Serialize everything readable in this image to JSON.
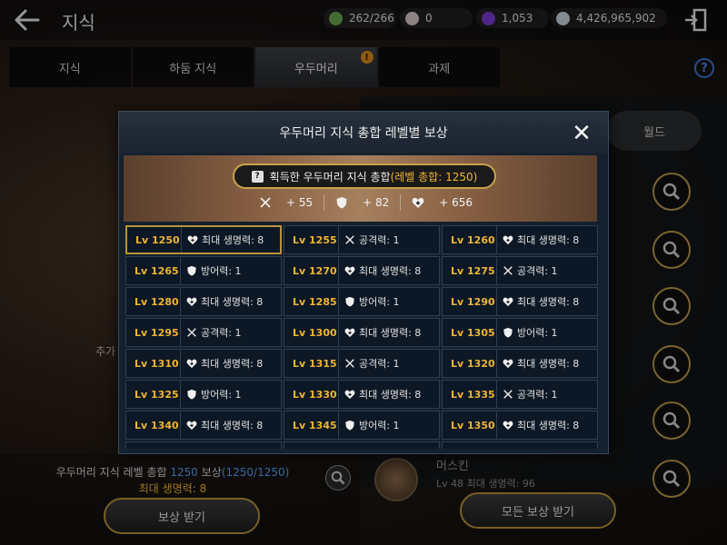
{
  "header": {
    "title": "지식",
    "resources": [
      {
        "name": "energy",
        "icon": "green-leaf-icon",
        "color": "#6aa84f",
        "value": "262/266"
      },
      {
        "name": "pearl",
        "icon": "pearl-icon",
        "color": "#d8c8c8",
        "value": "0"
      },
      {
        "name": "crystal",
        "icon": "purple-crystal-icon",
        "color": "#7a3ad0",
        "value": "1,053"
      },
      {
        "name": "silver",
        "icon": "silver-coin-icon",
        "color": "#c9d4e0",
        "value": "4,426,965,902"
      }
    ]
  },
  "tabs": [
    {
      "label": "지식",
      "active": false
    },
    {
      "label": "하둠 지식",
      "active": false
    },
    {
      "label": "우두머리",
      "active": true,
      "badge": "!"
    },
    {
      "label": "과제",
      "active": false
    }
  ],
  "background": {
    "world_tab": "월드",
    "left_label": "추가",
    "summary_line1_a": "우두머리 지식 레벨 총합 ",
    "summary_level": "1250",
    "summary_line1_b": " 보상",
    "summary_progress": "(1250/1250)",
    "summary_line2": "최대 생명력: 8",
    "reward_button": "보상 받기",
    "all_reward_button": "모든 보상 받기",
    "char_name": "머스킨",
    "char_sub": "Lv 48 최대 생명력: 96"
  },
  "modal": {
    "title": "우두머리 지식 총합 레벨별 보상",
    "banner": {
      "label": "획득한 우두머리 지식 총합",
      "total": "(레벨 총합: 1250)",
      "stats": [
        {
          "icon": "sword-icon",
          "value": "+ 55"
        },
        {
          "icon": "shield-icon",
          "value": "+ 82"
        },
        {
          "icon": "heart-icon",
          "value": "+ 656"
        }
      ]
    },
    "rewards": [
      {
        "lv": "Lv 1250",
        "icon": "heart-icon",
        "text": "최대 생명력: 8",
        "selected": true
      },
      {
        "lv": "Lv 1255",
        "icon": "sword-icon",
        "text": "공격력: 1"
      },
      {
        "lv": "Lv 1260",
        "icon": "heart-icon",
        "text": "최대 생명력: 8"
      },
      {
        "lv": "Lv 1265",
        "icon": "shield-icon",
        "text": "방어력: 1"
      },
      {
        "lv": "Lv 1270",
        "icon": "heart-icon",
        "text": "최대 생명력: 8"
      },
      {
        "lv": "Lv 1275",
        "icon": "sword-icon",
        "text": "공격력: 1"
      },
      {
        "lv": "Lv 1280",
        "icon": "heart-icon",
        "text": "최대 생명력: 8"
      },
      {
        "lv": "Lv 1285",
        "icon": "shield-icon",
        "text": "방어력: 1"
      },
      {
        "lv": "Lv 1290",
        "icon": "heart-icon",
        "text": "최대 생명력: 8"
      },
      {
        "lv": "Lv 1295",
        "icon": "sword-icon",
        "text": "공격력: 1"
      },
      {
        "lv": "Lv 1300",
        "icon": "heart-icon",
        "text": "최대 생명력: 8"
      },
      {
        "lv": "Lv 1305",
        "icon": "shield-icon",
        "text": "방어력: 1"
      },
      {
        "lv": "Lv 1310",
        "icon": "heart-icon",
        "text": "최대 생명력: 8"
      },
      {
        "lv": "Lv 1315",
        "icon": "sword-icon",
        "text": "공격력: 1"
      },
      {
        "lv": "Lv 1320",
        "icon": "heart-icon",
        "text": "최대 생명력: 8"
      },
      {
        "lv": "Lv 1325",
        "icon": "shield-icon",
        "text": "방어력: 1"
      },
      {
        "lv": "Lv 1330",
        "icon": "heart-icon",
        "text": "최대 생명력: 8"
      },
      {
        "lv": "Lv 1335",
        "icon": "sword-icon",
        "text": "공격력: 1"
      },
      {
        "lv": "Lv 1340",
        "icon": "heart-icon",
        "text": "최대 생명력: 8"
      },
      {
        "lv": "Lv 1345",
        "icon": "shield-icon",
        "text": "방어력: 1"
      },
      {
        "lv": "Lv 1350",
        "icon": "heart-icon",
        "text": "최대 생명력: 8"
      }
    ]
  }
}
